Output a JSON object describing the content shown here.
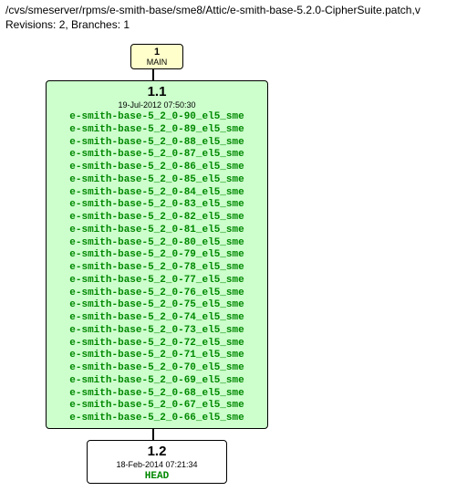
{
  "header": {
    "path": "/cvs/smeserver/rpms/e-smith-base/sme8/Attic/e-smith-base-5.2.0-CipherSuite.patch,v",
    "meta": "Revisions: 2, Branches: 1"
  },
  "branch": {
    "num": "1",
    "name": "MAIN"
  },
  "node1": {
    "version": "1.1",
    "date": "19-Jul-2012 07:50:30",
    "tags": [
      "e-smith-base-5_2_0-90_el5_sme",
      "e-smith-base-5_2_0-89_el5_sme",
      "e-smith-base-5_2_0-88_el5_sme",
      "e-smith-base-5_2_0-87_el5_sme",
      "e-smith-base-5_2_0-86_el5_sme",
      "e-smith-base-5_2_0-85_el5_sme",
      "e-smith-base-5_2_0-84_el5_sme",
      "e-smith-base-5_2_0-83_el5_sme",
      "e-smith-base-5_2_0-82_el5_sme",
      "e-smith-base-5_2_0-81_el5_sme",
      "e-smith-base-5_2_0-80_el5_sme",
      "e-smith-base-5_2_0-79_el5_sme",
      "e-smith-base-5_2_0-78_el5_sme",
      "e-smith-base-5_2_0-77_el5_sme",
      "e-smith-base-5_2_0-76_el5_sme",
      "e-smith-base-5_2_0-75_el5_sme",
      "e-smith-base-5_2_0-74_el5_sme",
      "e-smith-base-5_2_0-73_el5_sme",
      "e-smith-base-5_2_0-72_el5_sme",
      "e-smith-base-5_2_0-71_el5_sme",
      "e-smith-base-5_2_0-70_el5_sme",
      "e-smith-base-5_2_0-69_el5_sme",
      "e-smith-base-5_2_0-68_el5_sme",
      "e-smith-base-5_2_0-67_el5_sme",
      "e-smith-base-5_2_0-66_el5_sme"
    ],
    "ellipsis": "..."
  },
  "node2": {
    "version": "1.2",
    "date": "18-Feb-2014 07:21:34",
    "head": "HEAD"
  }
}
